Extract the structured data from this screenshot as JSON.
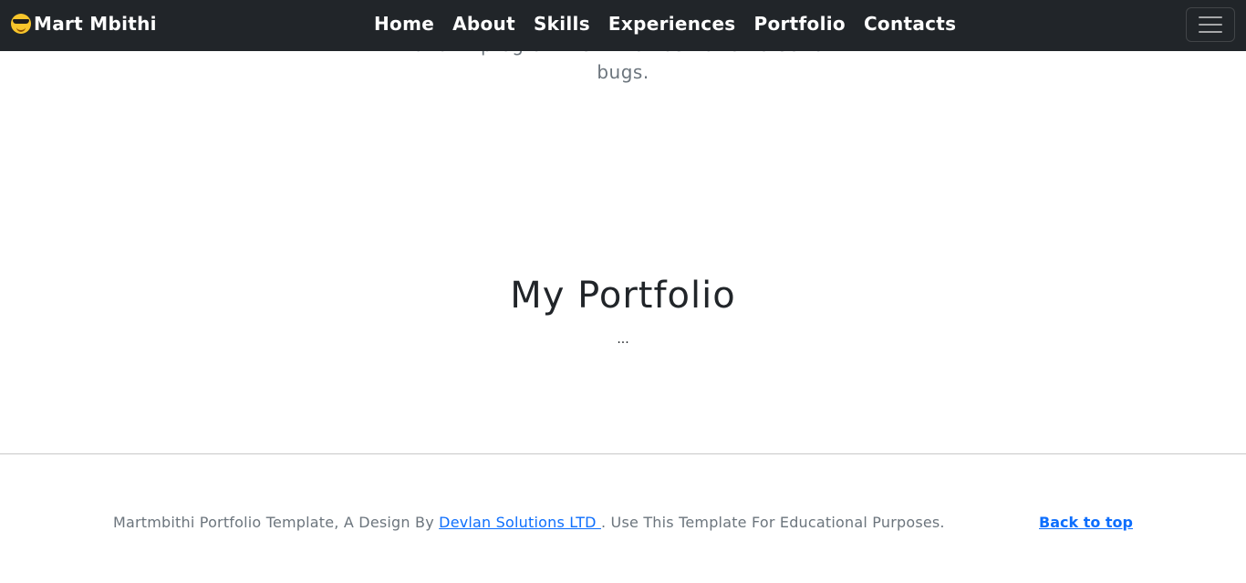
{
  "navbar": {
    "brand": "Mart Mbithi",
    "brand_icon": "sunglasses-emoji-icon",
    "items": [
      {
        "label": "Home"
      },
      {
        "label": "About"
      },
      {
        "label": "Skills"
      },
      {
        "label": "Experiences"
      },
      {
        "label": "Portfolio"
      },
      {
        "label": "Contacts"
      }
    ],
    "toggler_icon": "hamburger-menu-icon"
  },
  "intro": {
    "line1": "and ... programmer who has no remorse for",
    "line2": "bugs."
  },
  "portfolio": {
    "title": "My Portfolio",
    "subtitle": "..."
  },
  "footer": {
    "text_before": "Martmbithi Portfolio Template, A Design By ",
    "link_label": "Devlan Solutions LTD ",
    "text_after": ". Use This Template For Educational Purposes.",
    "back_to_top": "Back to top"
  },
  "colors": {
    "navbar_bg": "#212529",
    "link": "#0d6efd",
    "muted_text": "#6c757d"
  }
}
